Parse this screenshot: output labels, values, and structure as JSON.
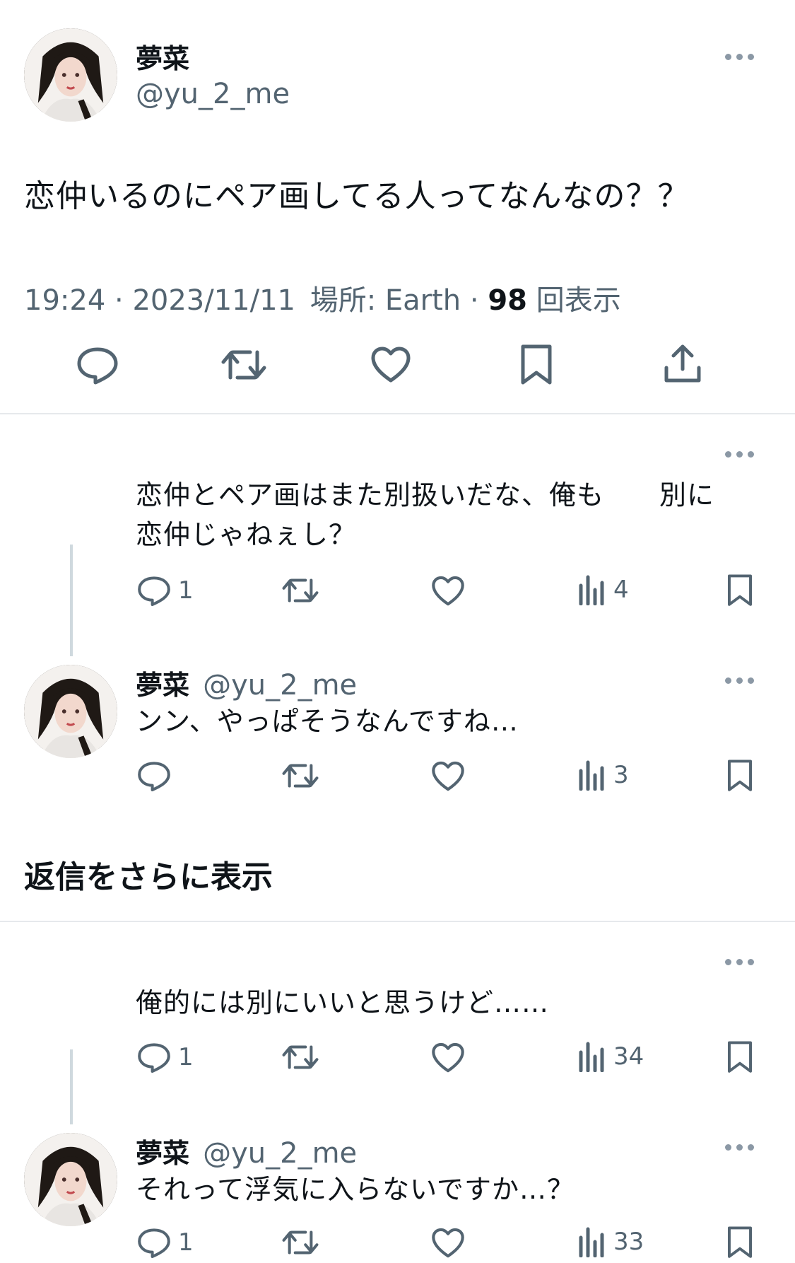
{
  "main_tweet": {
    "display_name": "夢菜",
    "handle": "@yu_2_me",
    "text": "恋仲いるのにペア画してる人ってなんなの？？",
    "time": "19:24",
    "date": "2023/11/11",
    "location_label": "場所: Earth",
    "views_count": "98",
    "views_label": "回表示",
    "actions": [
      "reply-icon",
      "retweet-icon",
      "like-icon",
      "bookmark-icon",
      "share-icon"
    ]
  },
  "replies": [
    {
      "has_avatar": false,
      "display_name": "",
      "handle": "",
      "text_line1": "恋仲とペア画はまた別扱いだな、俺も　　別に",
      "text_line2": "恋仲じゃねぇし？",
      "reply_count": "1",
      "views": "4"
    },
    {
      "has_avatar": true,
      "display_name": "夢菜",
      "handle": "@yu_2_me",
      "text_line1": "ンン、やっぱそうなんですね…",
      "reply_count": "",
      "views": "3"
    },
    {
      "has_avatar": false,
      "display_name": "",
      "handle": "",
      "text_line1": "俺的には別にいいと思うけど……",
      "reply_count": "1",
      "views": "34"
    },
    {
      "has_avatar": true,
      "display_name": "夢菜",
      "handle": "@yu_2_me",
      "text_line1": "それって浮気に入らないですか…？",
      "reply_count": "1",
      "views": "33"
    }
  ],
  "show_more_replies": "返信をさらに表示",
  "colors": {
    "text": "#0f1419",
    "secondary": "#536471",
    "divider": "#e6e9ec",
    "thread_line": "#cfd9de"
  }
}
